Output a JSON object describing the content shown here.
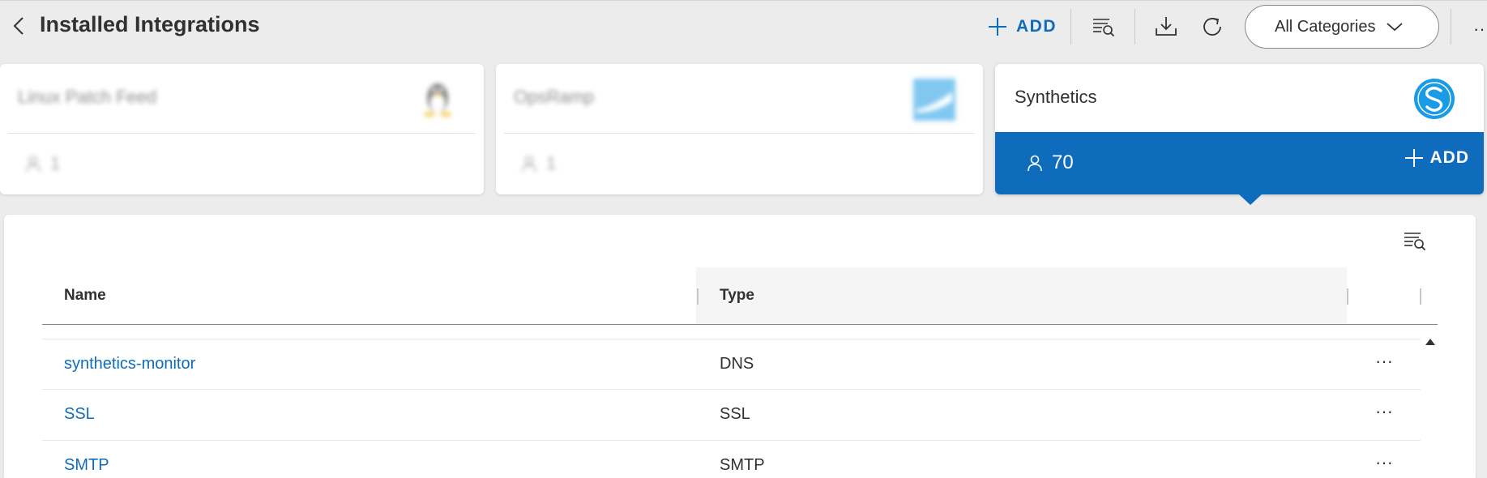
{
  "header": {
    "title": "Installed Integrations",
    "add_label": "ADD",
    "category_select": "All Categories"
  },
  "cards": [
    {
      "name": "Linux Patch Feed",
      "count": "1",
      "logo": "linux-tux-logo",
      "blurred": true
    },
    {
      "name": "OpsRamp",
      "count": "1",
      "logo": "opsramp-logo",
      "blurred": true
    },
    {
      "name": "Synthetics",
      "count": "70",
      "logo": "synthetics-logo",
      "add_label": "ADD",
      "selected": true
    }
  ],
  "table": {
    "columns": [
      "Name",
      "Type"
    ],
    "rows": [
      {
        "name": "synthetics-monitor",
        "type": "DNS"
      },
      {
        "name": "SSL",
        "type": "SSL"
      },
      {
        "name": "SMTP",
        "type": "SMTP"
      }
    ],
    "row_action": "···"
  },
  "colors": {
    "accent": "#0f6cbd",
    "header_bg": "#ececec"
  }
}
